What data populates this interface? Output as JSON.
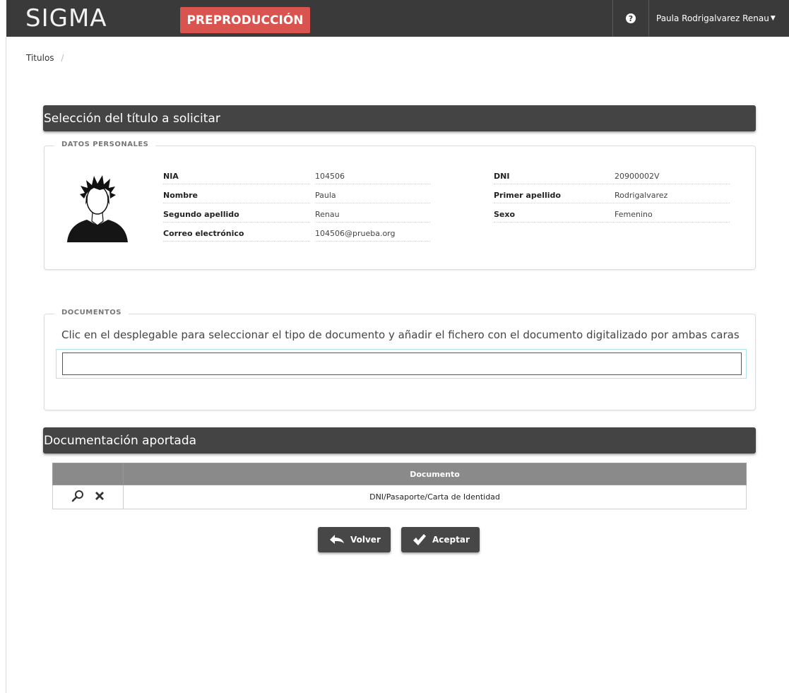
{
  "header": {
    "logo": "SIGMA",
    "environment_badge": "PREPRODUCCIÓN",
    "help_icon_glyph": "?",
    "user_name": "Paula Rodrigalvarez Renau"
  },
  "breadcrumb": {
    "item": "Titulos",
    "separator": "/"
  },
  "section_title": "Selección del título a solicitar",
  "personal_data": {
    "legend": "DATOS PERSONALES",
    "left": [
      {
        "label": "NIA",
        "value": "104506"
      },
      {
        "label": "Nombre",
        "value": "Paula"
      },
      {
        "label": "Segundo apellido",
        "value": "Renau"
      },
      {
        "label": "Correo electrónico",
        "value": "104506@prueba.org"
      }
    ],
    "right": [
      {
        "label": "DNI",
        "value": "20900002V"
      },
      {
        "label": "Primer apellido",
        "value": "Rodrigalvarez"
      },
      {
        "label": "Sexo",
        "value": "Femenino"
      }
    ]
  },
  "documents": {
    "legend": "DOCUMENTOS",
    "hint": "Clic en el desplegable para seleccionar el tipo de documento y añadir el fichero con el documento digitalizado por ambas caras",
    "select_value": ""
  },
  "provided_docs": {
    "title": "Documentación aportada",
    "columns": [
      "",
      "Documento"
    ],
    "rows": [
      {
        "document": "DNI/Pasaporte/Carta de Identidad"
      }
    ]
  },
  "buttons": {
    "back": "Volver",
    "accept": "Aceptar"
  },
  "colors": {
    "badge": "#d9534f",
    "topbar": "#3a3a3a",
    "section_bar": "#444444",
    "table_header": "#8a8a8a"
  }
}
